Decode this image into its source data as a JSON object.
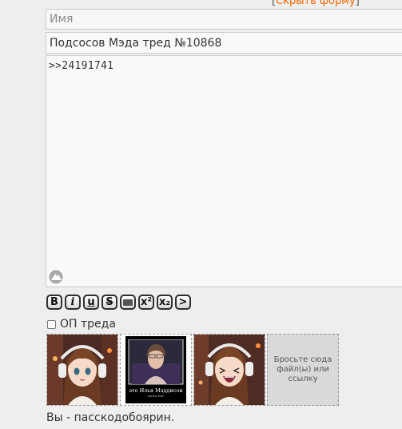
{
  "top_link": {
    "bracket_open": "[",
    "label": "Скрыть форму",
    "bracket_close": "]"
  },
  "form": {
    "name_placeholder": "Имя",
    "subject_value": "Подсосов Мэда тред №10868",
    "comment_value": ">>24191741"
  },
  "toolbar": {
    "buttons": [
      {
        "label": "B",
        "icon": "bold-icon"
      },
      {
        "label": "i",
        "icon": "italic-icon"
      },
      {
        "label": "u",
        "icon": "underline-icon"
      },
      {
        "label": "S",
        "icon": "strikethrough-icon"
      },
      {
        "label": "",
        "icon": "spoiler-icon"
      },
      {
        "label": "x²",
        "icon": "superscript-icon"
      },
      {
        "label": "x₂",
        "icon": "subscript-icon"
      },
      {
        "label": ">",
        "icon": "quote-icon"
      }
    ]
  },
  "op_checkbox": {
    "label": "ОП треда",
    "checked": false
  },
  "attachments": {
    "poster_caption": "это Илья Мэддисон",
    "poster_subcaption": "КОНЕЦ ЭТИХ",
    "drop_zone_label": "Бросьте сюда файл(ы) или ссылку"
  },
  "footer": {
    "status": "Вы - пасскодобоярин."
  },
  "colors": {
    "link": "#ff6600",
    "background": "#eeeeee",
    "field_border": "#cccccc"
  }
}
